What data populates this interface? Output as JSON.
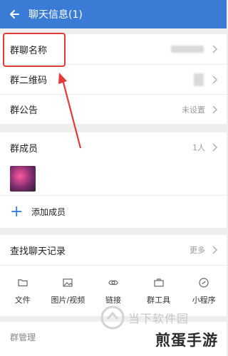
{
  "header": {
    "title": "聊天信息(1)"
  },
  "rows": {
    "name": {
      "label": "群聊名称"
    },
    "qr": {
      "label": "群二维码"
    },
    "notice": {
      "label": "群公告",
      "value": "未设置"
    }
  },
  "members": {
    "label": "群成员",
    "count": "1人",
    "add_label": "添加成员"
  },
  "history": {
    "label": "查找聊天记录",
    "more": "更多"
  },
  "tools": [
    {
      "label": "文件",
      "icon": "folder-icon"
    },
    {
      "label": "图片/视频",
      "icon": "image-icon"
    },
    {
      "label": "链接",
      "icon": "link-icon"
    },
    {
      "label": "群工具",
      "icon": "toolbox-icon"
    },
    {
      "label": "小程序",
      "icon": "mini-program-icon"
    }
  ],
  "manage": {
    "label": "群管理"
  },
  "watermark": {
    "text_a": "当下软件园",
    "text_b": "煎蛋手游"
  },
  "colors": {
    "header": "#3a7bd5",
    "highlight": "#e23a3a"
  }
}
